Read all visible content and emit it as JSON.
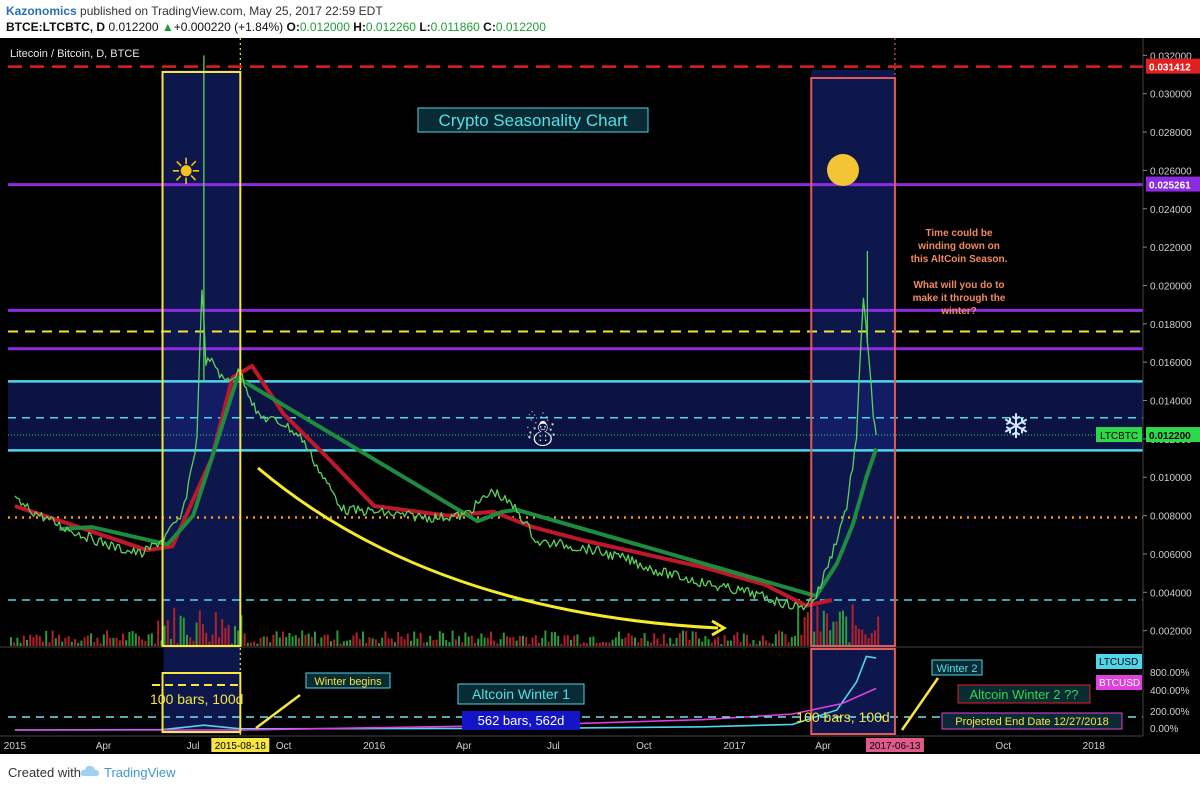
{
  "header": {
    "author": "Kazonomics",
    "published": "published on TradingView.com, May 25, 2017 22:59 EDT",
    "symbol_line": "BTCE:LTCBTC, D",
    "last": "0.012200",
    "arrow": "▲",
    "change": "+0.000220 (+1.84%)",
    "o_label": "O:",
    "o_val": "0.012000",
    "h_label": "H:",
    "h_val": "0.012260",
    "l_label": "L:",
    "l_val": "0.011860",
    "c_label": "C:",
    "c_val": "0.012200"
  },
  "chart_title": "Litecoin / Bitcoin, D, BTCE",
  "footer": {
    "created_with": "Created with",
    "brand": "TradingView"
  },
  "colors": {
    "background": "#000000",
    "candle_up": "#5bd35b",
    "candle_down": "#ff3b3b",
    "ma_fast": "#c0182b",
    "ma_slow": "#1e8c3e",
    "summer_box": "#f5e642",
    "summer_box_2": "#e05a5a",
    "purple_line": "#8a2be2",
    "cyan_line": "#4fd6ea",
    "red_dash": "#e02020",
    "yellow_dash": "#f2e33a",
    "orange_dots": "#f29a16",
    "ltcusd": "#4fd6ea",
    "btcusd": "#e040e0"
  },
  "chart_data": [
    {
      "type": "line",
      "title": "Litecoin / Bitcoin, D, BTCE",
      "ylabel": "",
      "ylim": [
        0.0012,
        0.0328
      ],
      "y_ticks": [
        "0.002000",
        "0.004000",
        "0.006000",
        "0.008000",
        "0.010000",
        "0.012000",
        "0.014000",
        "0.016000",
        "0.018000",
        "0.020000",
        "0.022000",
        "0.024000",
        "0.026000",
        "0.028000",
        "0.030000",
        "0.032000"
      ],
      "y_tick_values": [
        0.002,
        0.004,
        0.006,
        0.008,
        0.01,
        0.012,
        0.014,
        0.016,
        0.018,
        0.02,
        0.022,
        0.024,
        0.026,
        0.028,
        0.03,
        0.032
      ],
      "x_ticks": [
        "2015",
        "Apr",
        "Jul",
        "2015-08-18",
        "Oct",
        "2016",
        "Apr",
        "Jul",
        "Oct",
        "2017",
        "Apr",
        "2017-06-13",
        "Oct",
        "2018"
      ],
      "x_tick_dates": [
        "2015-01-01",
        "2015-04-01",
        "2015-07-01",
        "2015-08-18",
        "2015-10-01",
        "2016-01-01",
        "2016-04-01",
        "2016-07-01",
        "2016-10-01",
        "2017-01-01",
        "2017-04-01",
        "2017-06-13",
        "2017-10-01",
        "2018-01-01"
      ],
      "x_range": [
        "2014-12-25",
        "2018-02-20"
      ],
      "series": [
        {
          "name": "LTCBTC",
          "x": [
            "2015-01-01",
            "2015-01-20",
            "2015-02-15",
            "2015-03-15",
            "2015-04-15",
            "2015-05-10",
            "2015-06-01",
            "2015-06-20",
            "2015-07-05",
            "2015-07-10",
            "2015-07-14",
            "2015-07-22",
            "2015-08-01",
            "2015-08-18",
            "2015-09-05",
            "2015-10-01",
            "2015-10-20",
            "2015-11-10",
            "2015-12-01",
            "2016-01-01",
            "2016-02-01",
            "2016-03-01",
            "2016-04-01",
            "2016-05-01",
            "2016-05-25",
            "2016-06-15",
            "2016-07-10",
            "2016-08-10",
            "2016-09-15",
            "2016-10-15",
            "2016-11-15",
            "2016-12-15",
            "2017-01-15",
            "2017-02-15",
            "2017-03-10",
            "2017-03-25",
            "2017-04-10",
            "2017-04-25",
            "2017-05-05",
            "2017-05-12",
            "2017-05-18",
            "2017-05-22",
            "2017-05-25"
          ],
          "values": [
            0.0088,
            0.0082,
            0.0075,
            0.0069,
            0.0063,
            0.006,
            0.0068,
            0.008,
            0.012,
            0.02,
            0.016,
            0.016,
            0.015,
            0.0155,
            0.0132,
            0.0128,
            0.012,
            0.01,
            0.0083,
            0.0082,
            0.008,
            0.0079,
            0.008,
            0.0093,
            0.0083,
            0.0066,
            0.0065,
            0.0062,
            0.0057,
            0.0051,
            0.0047,
            0.0043,
            0.004,
            0.0035,
            0.0032,
            0.0038,
            0.006,
            0.0085,
            0.012,
            0.0195,
            0.016,
            0.013,
            0.0122
          ]
        },
        {
          "name": "MA fast (red)",
          "x": [
            "2015-01-01",
            "2015-03-01",
            "2015-05-15",
            "2015-06-10",
            "2015-07-20",
            "2015-08-10",
            "2015-08-30",
            "2015-10-01",
            "2015-11-15",
            "2016-01-01",
            "2016-03-15",
            "2016-05-01",
            "2016-06-10",
            "2016-08-01",
            "2016-10-01",
            "2016-12-01",
            "2017-02-01",
            "2017-03-15",
            "2017-04-10"
          ],
          "values": [
            0.0085,
            0.0075,
            0.0062,
            0.0064,
            0.011,
            0.0152,
            0.0158,
            0.0133,
            0.011,
            0.0085,
            0.008,
            0.0082,
            0.0074,
            0.0067,
            0.006,
            0.0053,
            0.0044,
            0.0033,
            0.0036
          ]
        },
        {
          "name": "MA slow (green)",
          "x": [
            "2015-02-15",
            "2015-03-20",
            "2015-06-05",
            "2015-07-01",
            "2015-07-20",
            "2015-08-15",
            "2016-04-15",
            "2016-05-10",
            "2016-05-25",
            "2017-03-25",
            "2017-04-15",
            "2017-05-01",
            "2017-05-15",
            "2017-05-25"
          ],
          "values": [
            0.0073,
            0.0074,
            0.0065,
            0.008,
            0.011,
            0.0152,
            0.0077,
            0.0082,
            0.0083,
            0.0038,
            0.0055,
            0.0075,
            0.01,
            0.0115
          ]
        }
      ],
      "horizontal_levels": [
        {
          "value": 0.031412,
          "label": "0.031412",
          "style": "red-dashed"
        },
        {
          "value": 0.025261,
          "label": "0.025261",
          "style": "purple-solid"
        },
        {
          "value": 0.0187,
          "style": "purple-solid"
        },
        {
          "value": 0.0176,
          "style": "yellow-dashed"
        },
        {
          "value": 0.0167,
          "style": "purple-solid"
        },
        {
          "value": 0.015,
          "style": "cyan-solid"
        },
        {
          "value": 0.0131,
          "style": "cyan-dashed"
        },
        {
          "value": 0.0114,
          "style": "cyan-solid"
        },
        {
          "value": 0.0079,
          "style": "orange-dotted"
        },
        {
          "value": 0.0036,
          "style": "cyan-dashed"
        }
      ],
      "last_price_label": "LTCBTC",
      "last_price_value": "0.012200",
      "annotations": {
        "title_box": "Crypto Seasonality Chart",
        "note_lines": [
          "Time could be",
          "winding down on",
          "this AltCoin Season.",
          "",
          "What will you do to",
          "make it through the",
          "winter?"
        ],
        "summer_1": [
          "2015-06-01",
          "2015-08-18"
        ],
        "summer_2": [
          "2017-03-20",
          "2017-06-13"
        ]
      }
    },
    {
      "type": "line",
      "title": "",
      "y_ticks": [
        "800.00%",
        "400.00%",
        "200.00%",
        "0.00%"
      ],
      "series": [
        {
          "name": "LTCUSD"
        },
        {
          "name": "BTCUSD"
        }
      ],
      "annotations": {
        "bars_1": "100 bars, 100d",
        "winter_begins": "Winter begins",
        "winter_1": "Altcoin Winter 1",
        "bars_562": "562 bars, 562d",
        "bars_2": "100 bars, 100d",
        "winter_2": "Winter 2",
        "winter_2_q": "Altcoin Winter 2 ??",
        "projected": "Projected End Date 12/27/2018"
      }
    }
  ]
}
